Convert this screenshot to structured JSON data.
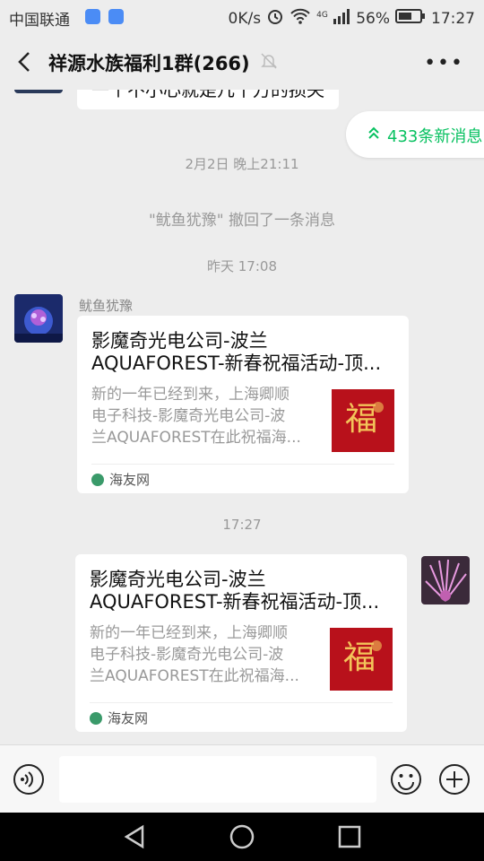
{
  "status_bar": {
    "carrier": "中国联通",
    "net_speed": "0K/s",
    "network_type": "4G",
    "battery": "56%",
    "time": "17:27"
  },
  "header": {
    "title": "祥源水族福利1群(266)",
    "back_icon": "chevron-left-icon",
    "mute_icon": "bell-off-icon",
    "more_icon": "more-dots-icon"
  },
  "chat": {
    "partial_message": "一个不小心就是几千万的损失",
    "new_messages_label": "433条新消息",
    "timestamp1": "2月2日 晚上21:11",
    "recall_notice": "\"鱿鱼犹豫\" 撤回了一条消息",
    "timestamp2": "昨天 17:08",
    "sender_name": "鱿鱼犹豫",
    "card1": {
      "title_line1": "影魔奇光电公司-波兰",
      "title_line2": "AQUAFOREST-新春祝福活动-顶...",
      "desc_line1": "新的一年已经到来，上海卿顺",
      "desc_line2": "电子科技-影魔奇光电公司-波",
      "desc_line3": "兰AQUAFOREST在此祝福海...",
      "thumb_text": "福",
      "source": "海友网"
    },
    "timestamp3": "17:27",
    "card2": {
      "title_line1": "影魔奇光电公司-波兰",
      "title_line2": "AQUAFOREST-新春祝福活动-顶...",
      "desc_line1": "新的一年已经到来，上海卿顺",
      "desc_line2": "电子科技-影魔奇光电公司-波",
      "desc_line3": "兰AQUAFOREST在此祝福海...",
      "thumb_text": "福",
      "source": "海友网"
    }
  },
  "input_bar": {
    "voice_icon": "voice-icon",
    "emoji_icon": "emoji-icon",
    "plus_icon": "plus-icon",
    "text_value": ""
  },
  "colors": {
    "accent_green": "#07c160",
    "background": "#ededed",
    "thumb_red": "#b8111b"
  }
}
